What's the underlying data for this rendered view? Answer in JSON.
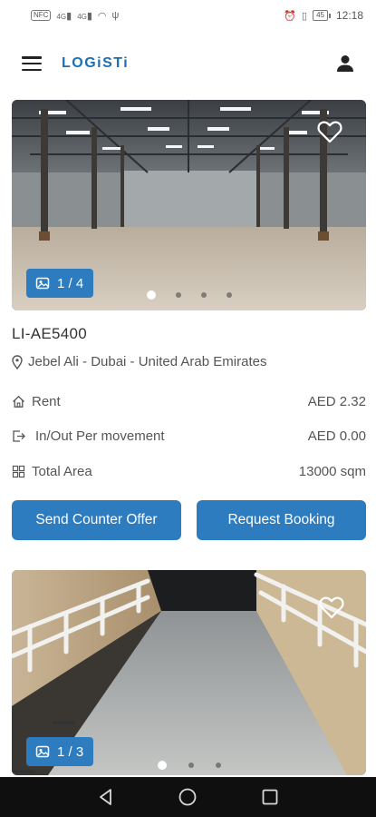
{
  "status_bar": {
    "left_chips": [
      "NFC",
      "4G",
      "4G"
    ],
    "battery": "45",
    "time": "12:18"
  },
  "app_bar": {
    "menu_icon": "hamburger-menu-icon",
    "logo": "LOGiSTi",
    "account_icon": "person-icon"
  },
  "listings": [
    {
      "image_counter": "1 / 4",
      "dots_total": 4,
      "dot_active": 1,
      "id": "LI-AE5400",
      "location": "Jebel Ali - Dubai - United Arab Emirates",
      "rows": [
        {
          "icon": "home-icon",
          "label": "Rent",
          "value": "AED 2.32"
        },
        {
          "icon": "exit-icon",
          "label": "In/Out Per movement",
          "value": "AED 0.00"
        },
        {
          "icon": "grid-icon",
          "label": "Total Area",
          "value": "13000 sqm"
        }
      ],
      "buttons": {
        "counter_offer": "Send Counter Offer",
        "request": "Request Booking"
      }
    },
    {
      "image_counter": "1 / 3",
      "dots_total": 3,
      "dot_active": 1
    }
  ],
  "colors": {
    "accent": "#2d7cc0",
    "logo": "#1f6fb0",
    "nav_bar": "#0f0f0f"
  }
}
